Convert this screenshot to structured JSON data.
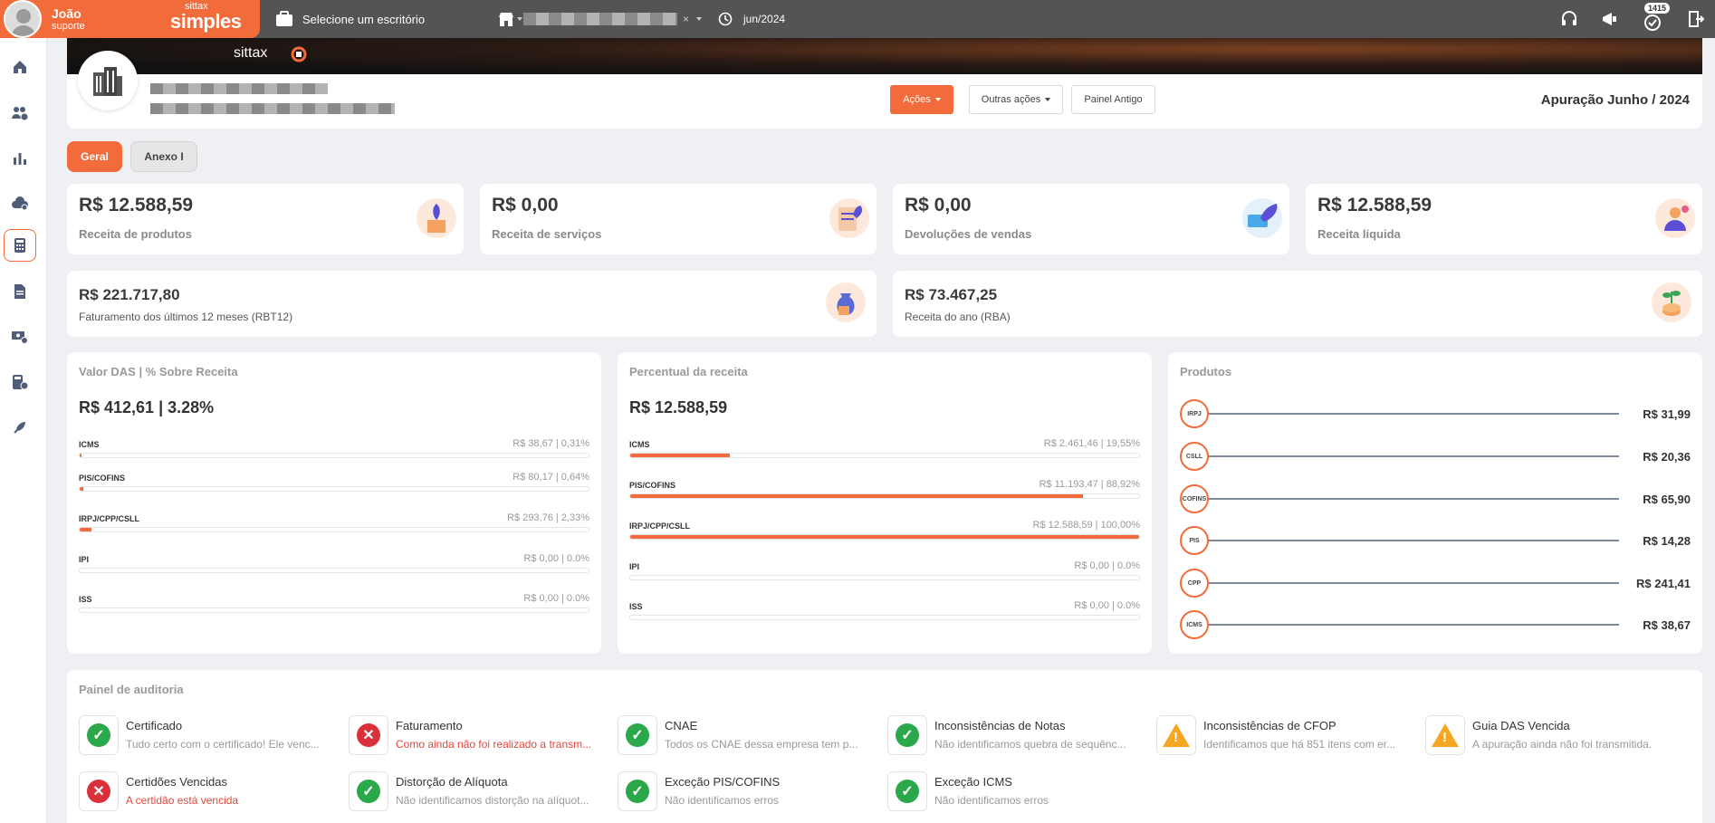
{
  "topbar": {
    "user_name": "João",
    "user_role": "suporte",
    "logo_small": "sittax",
    "logo_big": "simples",
    "office_selector": "Selecione um escritório",
    "period": "jun/2024",
    "notification_count": "1415"
  },
  "hero": {
    "brand": "sittax"
  },
  "company": {
    "actions_btn": "Ações",
    "other_actions_btn": "Outras ações",
    "old_panel_btn": "Painel Antigo",
    "title": "Apuração Junho / 2024"
  },
  "tabs": [
    {
      "label": "Geral"
    },
    {
      "label": "Anexo I"
    }
  ],
  "kpis": [
    {
      "value": "R$ 12.588,59",
      "label": "Receita de produtos"
    },
    {
      "value": "R$ 0,00",
      "label": "Receita de serviços"
    },
    {
      "value": "R$ 0,00",
      "label": "Devoluções de vendas"
    },
    {
      "value": "R$ 12.588,59",
      "label": "Receita líquida"
    }
  ],
  "totals": [
    {
      "value": "R$ 221.717,80",
      "label": "Faturamento dos últimos 12 meses (RBT12)"
    },
    {
      "value": "R$ 73.467,25",
      "label": "Receita do ano (RBA)"
    }
  ],
  "das": {
    "title": "Valor DAS | % Sobre Receita",
    "total": "R$ 412,61 | 3.28%",
    "rows": [
      {
        "label": "ICMS",
        "value": "R$ 38,67 | 0,31%",
        "pct": 0.31
      },
      {
        "label": "PIS/COFINS",
        "value": "R$ 80,17 | 0,64%",
        "pct": 0.64
      },
      {
        "label": "IRPJ/CPP/CSLL",
        "value": "R$ 293,76 | 2,33%",
        "pct": 2.33
      },
      {
        "label": "IPI",
        "value": "R$ 0,00 | 0.0%",
        "pct": 0
      },
      {
        "label": "ISS",
        "value": "R$ 0,00 | 0.0%",
        "pct": 0
      }
    ]
  },
  "receita": {
    "title": "Percentual da receita",
    "total": "R$ 12.588,59",
    "rows": [
      {
        "label": "ICMS",
        "value": "R$ 2.461,46 | 19,55%",
        "pct": 19.55
      },
      {
        "label": "PIS/COFINS",
        "value": "R$ 11.193,47 | 88,92%",
        "pct": 88.92
      },
      {
        "label": "IRPJ/CPP/CSLL",
        "value": "R$ 12.588,59 | 100,00%",
        "pct": 100
      },
      {
        "label": "IPI",
        "value": "R$ 0,00 | 0.0%",
        "pct": 0
      },
      {
        "label": "ISS",
        "value": "R$ 0,00 | 0.0%",
        "pct": 0
      }
    ]
  },
  "produtos": {
    "title": "Produtos",
    "rows": [
      {
        "label": "IRPJ",
        "value": "R$ 31,99"
      },
      {
        "label": "CSLL",
        "value": "R$ 20,36"
      },
      {
        "label": "COFINS",
        "value": "R$ 65,90"
      },
      {
        "label": "PIS",
        "value": "R$ 14,28"
      },
      {
        "label": "CPP",
        "value": "R$ 241,41"
      },
      {
        "label": "ICMS",
        "value": "R$ 38,67"
      }
    ]
  },
  "audit": {
    "title": "Painel de auditoria",
    "items": [
      {
        "title": "Certificado",
        "desc": "Tudo certo com o certificado! Ele venc...",
        "status": "ok"
      },
      {
        "title": "Faturamento",
        "desc": "Como ainda não foi realizado a transm...",
        "status": "error"
      },
      {
        "title": "CNAE",
        "desc": "Todos os CNAE dessa empresa tem p...",
        "status": "ok"
      },
      {
        "title": "Inconsistências de Notas",
        "desc": "Não identificamos quebra de sequênc...",
        "status": "ok"
      },
      {
        "title": "Inconsistências de CFOP",
        "desc": "Identificamos que há 851 itens com er...",
        "status": "warning"
      },
      {
        "title": "Guia DAS Vencida",
        "desc": "A apuração ainda não foi transmitida.",
        "status": "warning"
      },
      {
        "title": "Certidões Vencidas",
        "desc": "A certidão está vencida",
        "status": "error"
      },
      {
        "title": "Distorção de Alíquota",
        "desc": "Não identificamos distorção na alíquot...",
        "status": "ok"
      },
      {
        "title": "Exceção PIS/COFINS",
        "desc": "Não identificamos erros",
        "status": "ok"
      },
      {
        "title": "Exceção ICMS",
        "desc": "Não identificamos erros",
        "status": "ok"
      }
    ]
  },
  "colors": {
    "accent": "#f26b3a",
    "topbar": "#545454",
    "ok": "#2aa84a",
    "error": "#d9303a",
    "warning": "#f5a623"
  }
}
